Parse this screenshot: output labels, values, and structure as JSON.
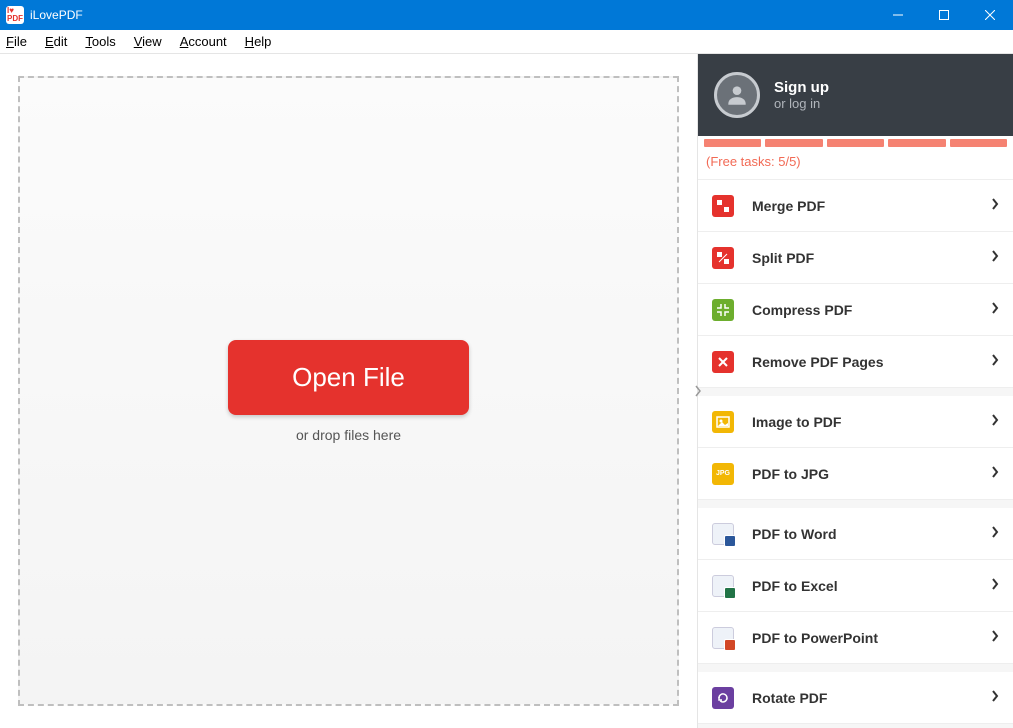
{
  "title": "iLovePDF",
  "menu": {
    "file": "File",
    "edit": "Edit",
    "tools": "Tools",
    "view": "View",
    "account": "Account",
    "help": "Help"
  },
  "dropzone": {
    "open_label": "Open File",
    "hint": "or drop files here"
  },
  "account": {
    "signup": "Sign up",
    "login": "or log in"
  },
  "free_tasks_label": "(Free tasks: 5/5)",
  "progress_segments": 5,
  "tools": [
    {
      "label": "Merge PDF",
      "icon": "merge",
      "color": "red",
      "gap": false
    },
    {
      "label": "Split PDF",
      "icon": "split",
      "color": "red",
      "gap": false
    },
    {
      "label": "Compress PDF",
      "icon": "compress",
      "color": "green",
      "gap": false
    },
    {
      "label": "Remove PDF Pages",
      "icon": "remove",
      "color": "red",
      "gap": false
    },
    {
      "label": "Image to PDF",
      "icon": "image",
      "color": "yellow",
      "gap": true
    },
    {
      "label": "PDF to JPG",
      "icon": "jpg",
      "color": "yellow",
      "gap": false
    },
    {
      "label": "PDF to Word",
      "icon": "word",
      "color": "blueish",
      "gap": true
    },
    {
      "label": "PDF to Excel",
      "icon": "excel",
      "color": "blueish",
      "gap": false
    },
    {
      "label": "PDF to PowerPoint",
      "icon": "ppt",
      "color": "blueish",
      "gap": false
    },
    {
      "label": "Rotate PDF",
      "icon": "rotate",
      "color": "purple",
      "gap": true
    }
  ]
}
